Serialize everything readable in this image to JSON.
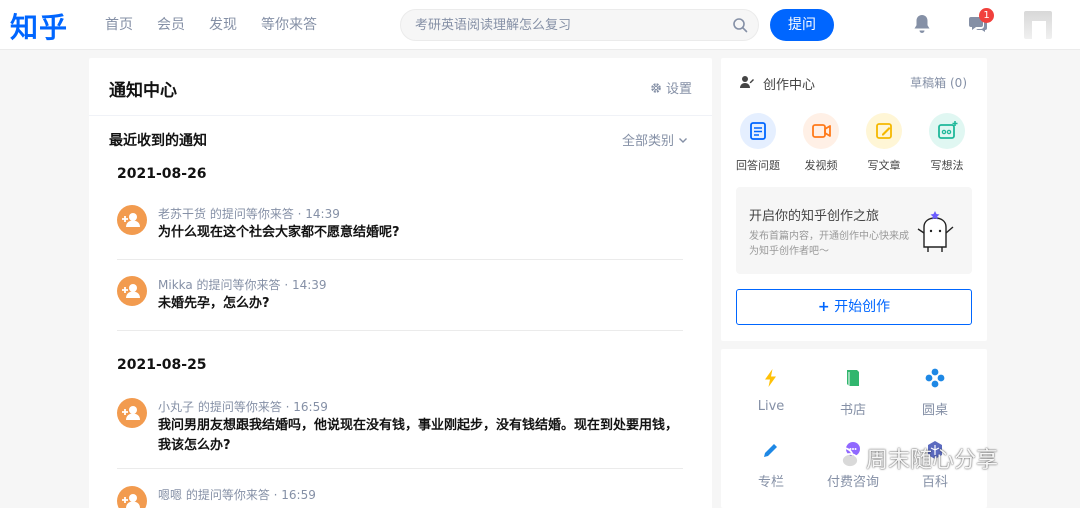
{
  "header": {
    "logo": "知乎",
    "nav": [
      "首页",
      "会员",
      "发现",
      "等你来答"
    ],
    "search_placeholder": "考研英语阅读理解怎么复习",
    "ask_label": "提问",
    "message_badge": "1"
  },
  "notifications": {
    "title": "通知中心",
    "settings_label": "设置",
    "subtitle": "最近收到的通知",
    "filter_label": "全部类别",
    "groups": [
      {
        "date": "2021-08-26",
        "items": [
          {
            "meta": "老苏干货 的提问等你来答 · 14:39",
            "question": "为什么现在这个社会大家都不愿意结婚呢?"
          },
          {
            "meta": "Mikka 的提问等你来答 · 14:39",
            "question": "未婚先孕，怎么办?"
          }
        ]
      },
      {
        "date": "2021-08-25",
        "items": [
          {
            "meta": "小丸子 的提问等你来答 · 16:59",
            "question": "我问男朋友想跟我结婚吗，他说现在没有钱，事业刚起步，没有钱结婚。现在到处要用钱，我该怎么办?"
          },
          {
            "meta": "嗯嗯 的提问等你来答 · 16:59",
            "question": ""
          }
        ]
      }
    ]
  },
  "creation": {
    "title": "创作中心",
    "drafts_label": "草稿箱",
    "drafts_count": "(0)",
    "actions": [
      "回答问题",
      "发视频",
      "写文章",
      "写想法"
    ],
    "promo_title": "开启你的知乎创作之旅",
    "promo_desc": "发布首篇内容，开通创作中心快来成为知乎创作者吧～",
    "start_label": "开始创作"
  },
  "shortcuts": [
    "Live",
    "书店",
    "圆桌",
    "专栏",
    "付费咨询",
    "百科"
  ],
  "watermark": "周末随心分享",
  "colors": {
    "brand": "#0066ff",
    "avatar_orange": "#f29b4f",
    "badge_red": "#f1403c"
  }
}
